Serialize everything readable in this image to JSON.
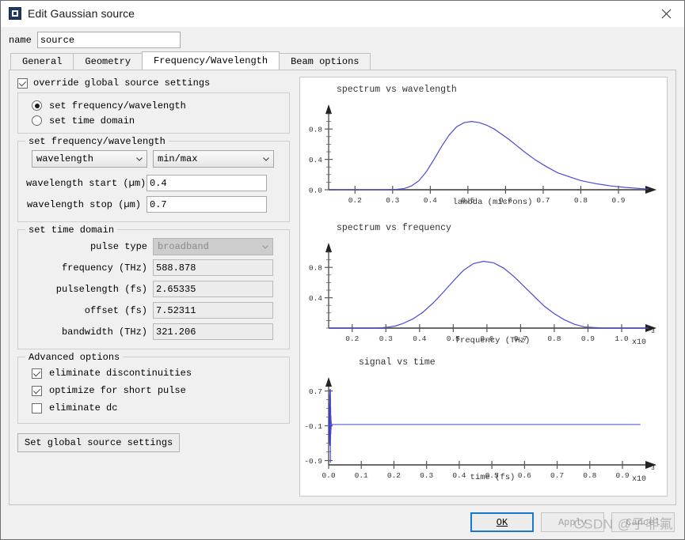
{
  "window": {
    "title": "Edit Gaussian source",
    "icon": "app-square-icon",
    "close_icon": "close-icon"
  },
  "name_field": {
    "label": "name",
    "value": "source",
    "placeholder": ""
  },
  "tabs": [
    {
      "label": "General",
      "active": false
    },
    {
      "label": "Geometry",
      "active": false
    },
    {
      "label": "Frequency/Wavelength",
      "active": true
    },
    {
      "label": "Beam options",
      "active": false
    }
  ],
  "override": {
    "label": "override global source settings",
    "checked": true
  },
  "mode_group": {
    "options": [
      {
        "label": "set frequency/wavelength",
        "selected": true
      },
      {
        "label": "set time domain",
        "selected": false
      }
    ]
  },
  "freq_wavelength_group": {
    "legend": "set frequency/wavelength",
    "selects": [
      {
        "name": "quantity-select",
        "value": "wavelength",
        "chevron": "chevron-down-icon"
      },
      {
        "name": "range-mode-select",
        "value": "min/max",
        "chevron": "chevron-down-icon"
      }
    ],
    "fields": [
      {
        "label": "wavelength start (µm)",
        "value": "0.4",
        "disabled": false
      },
      {
        "label": "wavelength stop (µm)",
        "value": "0.7",
        "disabled": false
      }
    ]
  },
  "time_domain_group": {
    "legend": "set time domain",
    "pulse_type": {
      "label": "pulse type",
      "value": "broadband",
      "disabled": true,
      "chevron": "chevron-down-icon"
    },
    "fields": [
      {
        "label": "frequency (THz)",
        "value": "588.878",
        "disabled": true
      },
      {
        "label": "pulselength (fs)",
        "value": "2.65335",
        "disabled": true
      },
      {
        "label": "offset (fs)",
        "value": "7.52311",
        "disabled": true
      },
      {
        "label": "bandwidth (THz)",
        "value": "321.206",
        "disabled": true
      }
    ]
  },
  "advanced_group": {
    "legend": "Advanced options",
    "options": [
      {
        "label": "eliminate discontinuities",
        "checked": true
      },
      {
        "label": "optimize for short pulse",
        "checked": true
      },
      {
        "label": "eliminate dc",
        "checked": false
      }
    ]
  },
  "global_button": {
    "label": "Set global source settings"
  },
  "footer": {
    "ok": "OK",
    "apply": "Apply",
    "cancel": "Cancel",
    "watermark": "CSDN @子非氟"
  },
  "colors": {
    "curve": "#4a4ad4",
    "axis": "#555555",
    "accent": "#1679d1",
    "panel": "#f0f0f0"
  },
  "chart_data": [
    {
      "type": "line",
      "name": "spectrum-vs-wavelength",
      "title": "spectrum vs wavelength",
      "xlabel": "lambda (microns)",
      "ylabel": "",
      "xticks": [
        0.2,
        0.3,
        0.4,
        0.5,
        0.6,
        0.7,
        0.8,
        0.9
      ],
      "xtick_labels": [
        "0.2",
        "0.3",
        "0.4",
        "0.5",
        "0.6",
        "0.7",
        "0.8",
        "0.9"
      ],
      "yticks": [
        0.0,
        0.4,
        0.8
      ],
      "ytick_labels": [
        "0.0",
        "0.4",
        "0.8"
      ],
      "xlim": [
        0.13,
        0.98
      ],
      "ylim": [
        0.0,
        1.0
      ],
      "exponent": "",
      "grid": false,
      "peak_x": 0.51,
      "peak_y": 0.9,
      "x": [
        0.13,
        0.18,
        0.23,
        0.28,
        0.31,
        0.33,
        0.35,
        0.37,
        0.39,
        0.41,
        0.43,
        0.45,
        0.47,
        0.49,
        0.51,
        0.53,
        0.55,
        0.57,
        0.59,
        0.61,
        0.63,
        0.65,
        0.68,
        0.71,
        0.74,
        0.77,
        0.8,
        0.84,
        0.88,
        0.92,
        0.96,
        0.98
      ],
      "y": [
        0.0,
        0.0,
        0.0,
        0.0,
        0.005,
        0.015,
        0.05,
        0.12,
        0.24,
        0.4,
        0.57,
        0.72,
        0.83,
        0.885,
        0.9,
        0.885,
        0.85,
        0.8,
        0.73,
        0.66,
        0.58,
        0.5,
        0.39,
        0.3,
        0.22,
        0.17,
        0.12,
        0.08,
        0.05,
        0.03,
        0.015,
        0.01
      ]
    },
    {
      "type": "line",
      "name": "spectrum-vs-frequency",
      "title": "spectrum vs frequency",
      "xlabel": "frequency (THz)",
      "ylabel": "",
      "xticks": [
        0.2,
        0.3,
        0.4,
        0.5,
        0.6,
        0.7,
        0.8,
        0.9,
        1.0
      ],
      "xtick_labels": [
        "0.2",
        "0.3",
        "0.4",
        "0.5",
        "0.6",
        "0.7",
        "0.8",
        "0.9",
        "1.0"
      ],
      "yticks": [
        0.4,
        0.8
      ],
      "ytick_labels": [
        "0.4",
        "0.8"
      ],
      "xlim": [
        0.13,
        1.08
      ],
      "ylim": [
        0.0,
        1.0
      ],
      "exponent": "x10",
      "exponent_power": "3",
      "grid": false,
      "peak_x": 0.59,
      "peak_y": 0.88,
      "x": [
        0.13,
        0.2,
        0.26,
        0.29,
        0.31,
        0.33,
        0.35,
        0.38,
        0.41,
        0.44,
        0.47,
        0.5,
        0.53,
        0.56,
        0.59,
        0.62,
        0.65,
        0.68,
        0.71,
        0.74,
        0.77,
        0.8,
        0.83,
        0.86,
        0.89,
        0.95,
        1.02,
        1.08
      ],
      "y": [
        0.0,
        0.0,
        0.0,
        0.005,
        0.015,
        0.03,
        0.06,
        0.12,
        0.21,
        0.33,
        0.47,
        0.62,
        0.76,
        0.85,
        0.88,
        0.86,
        0.79,
        0.68,
        0.55,
        0.42,
        0.29,
        0.19,
        0.11,
        0.05,
        0.015,
        0.0,
        0.0,
        0.0
      ]
    },
    {
      "type": "line",
      "name": "signal-vs-time",
      "title": "signal vs time",
      "xlabel": "time (fs)",
      "ylabel": "",
      "xticks": [
        0.0,
        0.1,
        0.2,
        0.3,
        0.4,
        0.5,
        0.6,
        0.7,
        0.8,
        0.9
      ],
      "xtick_labels": [
        "0.0",
        "0.1",
        "0.2",
        "0.3",
        "0.4",
        "0.5",
        "0.6",
        "0.7",
        "0.8",
        "0.9"
      ],
      "yticks": [
        -0.9,
        -0.1,
        0.7
      ],
      "ytick_labels": [
        "-0.9",
        "-0.1",
        "0.7"
      ],
      "xlim": [
        0.0,
        0.98
      ],
      "ylim": [
        -1.0,
        0.8
      ],
      "exponent": "x10",
      "exponent_power": "3",
      "grid": false,
      "baseline_y": -0.07,
      "burst_x": 0.006,
      "burst_max": 0.74,
      "burst_min": -0.95,
      "note": "narrow oscillating pulse burst at t~0 spanning full y range, flat baseline line afterwards"
    }
  ]
}
